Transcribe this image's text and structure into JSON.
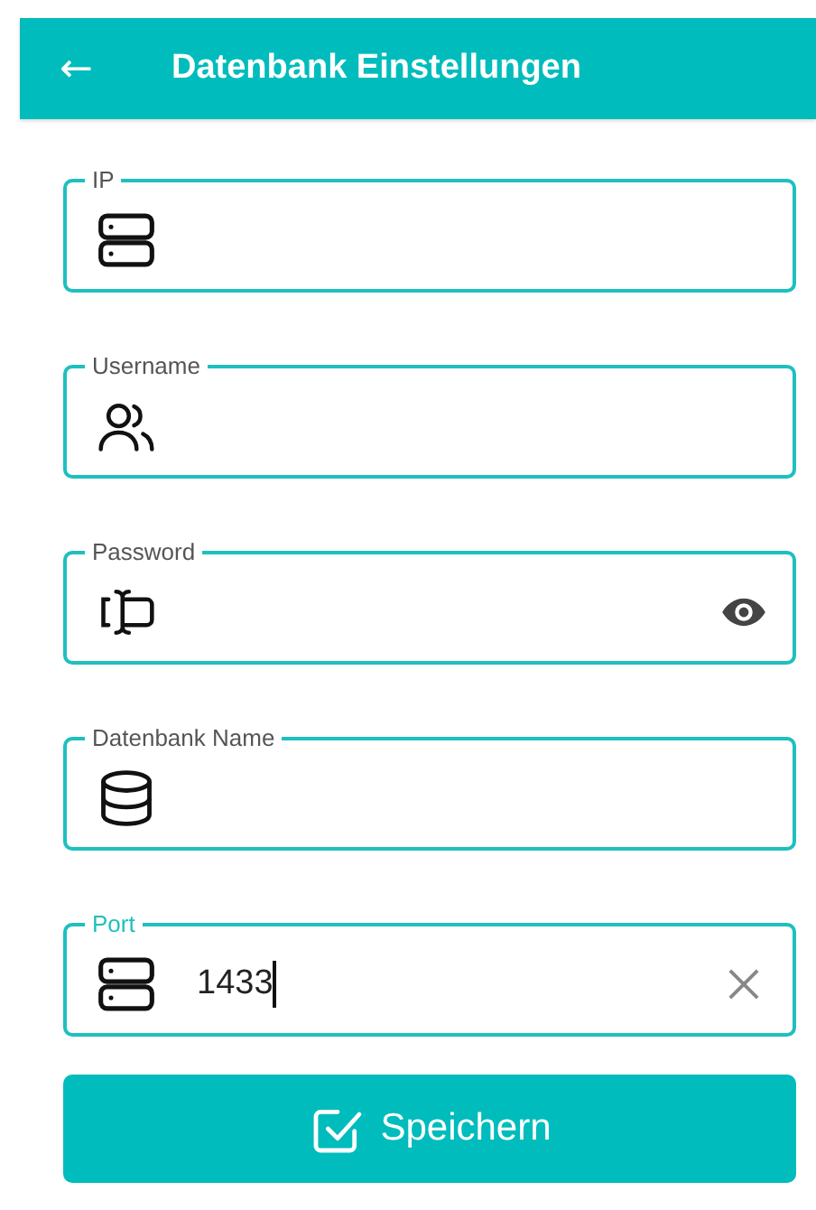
{
  "app_bar": {
    "back_icon": "←",
    "title": "Datenbank Einstellungen"
  },
  "fields": [
    {
      "label": "IP",
      "focused": false
    },
    {
      "label": "Username",
      "focused": false
    },
    {
      "label": "Password",
      "focused": false
    },
    {
      "label": "Datenbank Name",
      "focused": false
    },
    {
      "label": "Port",
      "value": "1433",
      "focused": true
    }
  ],
  "save_button": {
    "label": "Speichern"
  }
}
